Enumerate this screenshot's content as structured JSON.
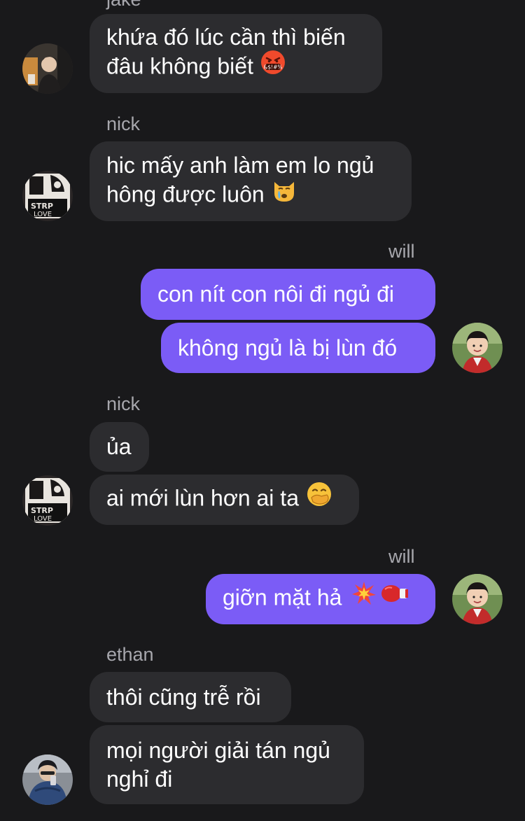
{
  "colors": {
    "background": "#19191b",
    "incoming_bubble": "#2c2c2f",
    "outgoing_bubble": "#7b5cf6",
    "sender_name": "#a7a7ad",
    "text": "#ffffff"
  },
  "messages": {
    "jake": {
      "sender": "jake",
      "bubble1": {
        "line1": "khứa đó lúc cần thì biến",
        "line2": "đâu không biết",
        "emoji": "enraged-face-with-symbols-icon"
      }
    },
    "nick1": {
      "sender": "nick",
      "bubble1": {
        "line1": "hic mấy anh làm em lo ngủ",
        "line2": "hông được luôn",
        "emoji": "crying-cat-icon"
      }
    },
    "will1": {
      "sender": "will",
      "bubble1": "con nít con nôi đi ngủ đi",
      "bubble2": "không ngủ là bị lùn đó"
    },
    "nick2": {
      "sender": "nick",
      "bubble1": "ủa",
      "bubble2": {
        "text": "ai mới lùn hơn ai ta",
        "emoji": "face-with-hand-over-mouth-icon"
      }
    },
    "will2": {
      "sender": "will",
      "bubble1": {
        "text": "giỡn mặt hả",
        "emojis": [
          "collision-icon",
          "boxing-glove-icon"
        ]
      }
    },
    "ethan": {
      "sender": "ethan",
      "bubble1": "thôi cũng trễ rồi",
      "bubble2": {
        "line1": "mọi người giải tán ngủ",
        "line2": "nghỉ đi"
      }
    }
  }
}
